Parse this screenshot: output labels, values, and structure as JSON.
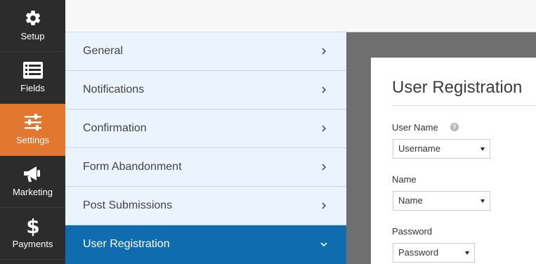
{
  "sidebar": {
    "items": [
      {
        "label": "Setup",
        "icon": "gear-icon"
      },
      {
        "label": "Fields",
        "icon": "fields-list-icon"
      },
      {
        "label": "Settings",
        "icon": "sliders-icon",
        "active": true
      },
      {
        "label": "Marketing",
        "icon": "megaphone-icon"
      },
      {
        "label": "Payments",
        "icon": "dollar-icon"
      }
    ]
  },
  "settings_menu": {
    "items": [
      {
        "label": "General"
      },
      {
        "label": "Notifications"
      },
      {
        "label": "Confirmation"
      },
      {
        "label": "Form Abandonment"
      },
      {
        "label": "Post Submissions"
      },
      {
        "label": "User Registration",
        "selected": true
      }
    ]
  },
  "form": {
    "title": "User Registration",
    "fields": [
      {
        "label": "User Name",
        "value": "Username",
        "has_help": true
      },
      {
        "label": "Name",
        "value": "Name"
      },
      {
        "label": "Password",
        "value": "Password"
      }
    ]
  },
  "colors": {
    "sidebar_bg": "#2c2c2c",
    "sidebar_active": "#e27730",
    "menu_bg": "#ebf3fc",
    "menu_selected": "#0e6caf",
    "preview_bg": "#6f6f6f"
  }
}
